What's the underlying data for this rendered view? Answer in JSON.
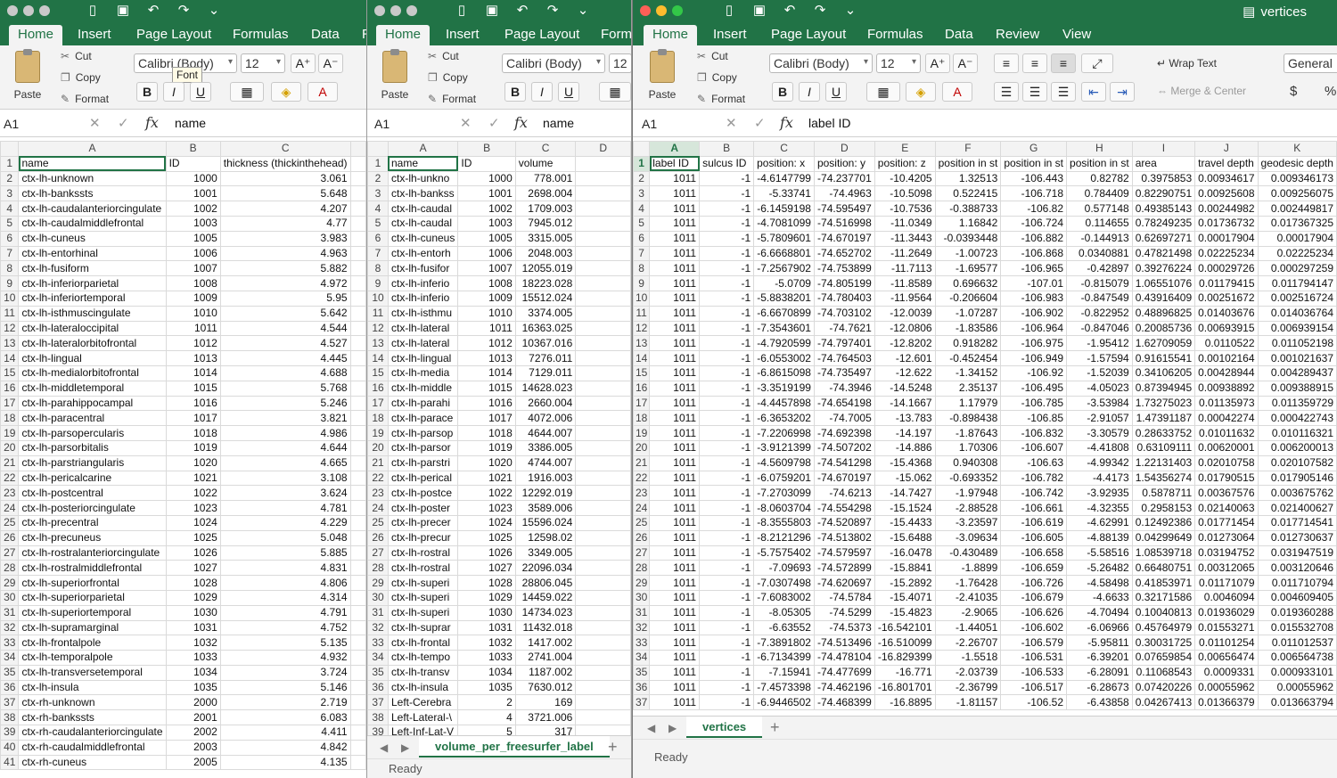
{
  "colors": {
    "accent": "#217346",
    "ribbon_bg": "#f3f3f3"
  },
  "icons": [
    "close-light",
    "minimize-light",
    "zoom-light",
    "sidebar-icon",
    "save-icon",
    "undo-icon",
    "redo-icon",
    "customize-icon",
    "cut-icon",
    "copy-icon",
    "format-painter-icon",
    "excel-doc-icon"
  ],
  "win1": {
    "tabs": [
      "Home",
      "Insert",
      "Page Layout",
      "Formulas",
      "Data",
      "R"
    ],
    "font_name": "Calibri (Body)",
    "font_size": "12",
    "tooltip": "Font",
    "clip": {
      "paste": "Paste",
      "cut": "Cut",
      "copy": "Copy",
      "format": "Format"
    },
    "namebox": "A1",
    "formula": "name",
    "headers": [
      "A",
      "B",
      "C"
    ],
    "rows": [
      [
        "name",
        "ID",
        "thickness (thickinthehead)"
      ],
      [
        "ctx-lh-unknown",
        "1000",
        "3.061"
      ],
      [
        "ctx-lh-bankssts",
        "1001",
        "5.648"
      ],
      [
        "ctx-lh-caudalanteriorcingulate",
        "1002",
        "4.207"
      ],
      [
        "ctx-lh-caudalmiddlefrontal",
        "1003",
        "4.77"
      ],
      [
        "ctx-lh-cuneus",
        "1005",
        "3.983"
      ],
      [
        "ctx-lh-entorhinal",
        "1006",
        "4.963"
      ],
      [
        "ctx-lh-fusiform",
        "1007",
        "5.882"
      ],
      [
        "ctx-lh-inferiorparietal",
        "1008",
        "4.972"
      ],
      [
        "ctx-lh-inferiortemporal",
        "1009",
        "5.95"
      ],
      [
        "ctx-lh-isthmuscingulate",
        "1010",
        "5.642"
      ],
      [
        "ctx-lh-lateraloccipital",
        "1011",
        "4.544"
      ],
      [
        "ctx-lh-lateralorbitofrontal",
        "1012",
        "4.527"
      ],
      [
        "ctx-lh-lingual",
        "1013",
        "4.445"
      ],
      [
        "ctx-lh-medialorbitofrontal",
        "1014",
        "4.688"
      ],
      [
        "ctx-lh-middletemporal",
        "1015",
        "5.768"
      ],
      [
        "ctx-lh-parahippocampal",
        "1016",
        "5.246"
      ],
      [
        "ctx-lh-paracentral",
        "1017",
        "3.821"
      ],
      [
        "ctx-lh-parsopercularis",
        "1018",
        "4.986"
      ],
      [
        "ctx-lh-parsorbitalis",
        "1019",
        "4.644"
      ],
      [
        "ctx-lh-parstriangularis",
        "1020",
        "4.665"
      ],
      [
        "ctx-lh-pericalcarine",
        "1021",
        "3.108"
      ],
      [
        "ctx-lh-postcentral",
        "1022",
        "3.624"
      ],
      [
        "ctx-lh-posteriorcingulate",
        "1023",
        "4.781"
      ],
      [
        "ctx-lh-precentral",
        "1024",
        "4.229"
      ],
      [
        "ctx-lh-precuneus",
        "1025",
        "5.048"
      ],
      [
        "ctx-lh-rostralanteriorcingulate",
        "1026",
        "5.885"
      ],
      [
        "ctx-lh-rostralmiddlefrontal",
        "1027",
        "4.831"
      ],
      [
        "ctx-lh-superiorfrontal",
        "1028",
        "4.806"
      ],
      [
        "ctx-lh-superiorparietal",
        "1029",
        "4.314"
      ],
      [
        "ctx-lh-superiortemporal",
        "1030",
        "4.791"
      ],
      [
        "ctx-lh-supramarginal",
        "1031",
        "4.752"
      ],
      [
        "ctx-lh-frontalpole",
        "1032",
        "5.135"
      ],
      [
        "ctx-lh-temporalpole",
        "1033",
        "4.932"
      ],
      [
        "ctx-lh-transversetemporal",
        "1034",
        "3.724"
      ],
      [
        "ctx-lh-insula",
        "1035",
        "5.146"
      ],
      [
        "ctx-rh-unknown",
        "2000",
        "2.719"
      ],
      [
        "ctx-rh-bankssts",
        "2001",
        "6.083"
      ],
      [
        "ctx-rh-caudalanteriorcingulate",
        "2002",
        "4.411"
      ],
      [
        "ctx-rh-caudalmiddlefrontal",
        "2003",
        "4.842"
      ],
      [
        "ctx-rh-cuneus",
        "2005",
        "4.135"
      ]
    ]
  },
  "win2": {
    "tabs": [
      "Home",
      "Insert",
      "Page Layout",
      "Form"
    ],
    "font_name": "Calibri (Body)",
    "font_size": "12",
    "clip": {
      "paste": "Paste",
      "cut": "Cut",
      "copy": "Copy",
      "format": "Format"
    },
    "namebox": "A1",
    "formula": "name",
    "headers": [
      "A",
      "B",
      "C",
      "D"
    ],
    "rows": [
      [
        "name",
        "ID",
        "volume"
      ],
      [
        "ctx-lh-unkno",
        "1000",
        "778.001"
      ],
      [
        "ctx-lh-bankss",
        "1001",
        "2698.004"
      ],
      [
        "ctx-lh-caudal",
        "1002",
        "1709.003"
      ],
      [
        "ctx-lh-caudal",
        "1003",
        "7945.012"
      ],
      [
        "ctx-lh-cuneus",
        "1005",
        "3315.005"
      ],
      [
        "ctx-lh-entorh",
        "1006",
        "2048.003"
      ],
      [
        "ctx-lh-fusifor",
        "1007",
        "12055.019"
      ],
      [
        "ctx-lh-inferio",
        "1008",
        "18223.028"
      ],
      [
        "ctx-lh-inferio",
        "1009",
        "15512.024"
      ],
      [
        "ctx-lh-isthmu",
        "1010",
        "3374.005"
      ],
      [
        "ctx-lh-lateral",
        "1011",
        "16363.025"
      ],
      [
        "ctx-lh-lateral",
        "1012",
        "10367.016"
      ],
      [
        "ctx-lh-lingual",
        "1013",
        "7276.011"
      ],
      [
        "ctx-lh-media",
        "1014",
        "7129.011"
      ],
      [
        "ctx-lh-middle",
        "1015",
        "14628.023"
      ],
      [
        "ctx-lh-parahi",
        "1016",
        "2660.004"
      ],
      [
        "ctx-lh-parace",
        "1017",
        "4072.006"
      ],
      [
        "ctx-lh-parsop",
        "1018",
        "4644.007"
      ],
      [
        "ctx-lh-parsor",
        "1019",
        "3386.005"
      ],
      [
        "ctx-lh-parstri",
        "1020",
        "4744.007"
      ],
      [
        "ctx-lh-perical",
        "1021",
        "1916.003"
      ],
      [
        "ctx-lh-postce",
        "1022",
        "12292.019"
      ],
      [
        "ctx-lh-poster",
        "1023",
        "3589.006"
      ],
      [
        "ctx-lh-precer",
        "1024",
        "15596.024"
      ],
      [
        "ctx-lh-precur",
        "1025",
        "12598.02"
      ],
      [
        "ctx-lh-rostral",
        "1026",
        "3349.005"
      ],
      [
        "ctx-lh-rostral",
        "1027",
        "22096.034"
      ],
      [
        "ctx-lh-superi",
        "1028",
        "28806.045"
      ],
      [
        "ctx-lh-superi",
        "1029",
        "14459.022"
      ],
      [
        "ctx-lh-superi",
        "1030",
        "14734.023"
      ],
      [
        "ctx-lh-suprar",
        "1031",
        "11432.018"
      ],
      [
        "ctx-lh-frontal",
        "1032",
        "1417.002"
      ],
      [
        "ctx-lh-tempo",
        "1033",
        "2741.004"
      ],
      [
        "ctx-lh-transv",
        "1034",
        "1187.002"
      ],
      [
        "ctx-lh-insula",
        "1035",
        "7630.012"
      ],
      [
        "Left-Cerebra",
        "2",
        "169"
      ],
      [
        "Left-Lateral-\\",
        "4",
        "3721.006"
      ],
      [
        "Left-Inf-Lat-V",
        "5",
        "317"
      ]
    ],
    "sheet": "volume_per_freesurfer_label",
    "plus": "+",
    "status": "Ready"
  },
  "win3": {
    "title": "vertices",
    "tabs": [
      "Home",
      "Insert",
      "Page Layout",
      "Formulas",
      "Data",
      "Review",
      "View"
    ],
    "font_name": "Calibri (Body)",
    "font_size": "12",
    "clip": {
      "paste": "Paste",
      "cut": "Cut",
      "copy": "Copy",
      "format": "Format"
    },
    "wrap": "Wrap Text",
    "merge": "Merge & Center",
    "numfmt": "General",
    "dollar": "$",
    "pct": "%",
    "namebox": "A1",
    "formula": "label ID",
    "headers": [
      "A",
      "B",
      "C",
      "D",
      "E",
      "F",
      "G",
      "H",
      "I",
      "J",
      "K"
    ],
    "rows": [
      [
        "label ID",
        "sulcus ID",
        "position: x",
        "position: y",
        "position: z",
        "position in st",
        "position in st",
        "position in st",
        "area",
        "travel depth",
        "geodesic depth"
      ],
      [
        "1011",
        "-1",
        "-4.6147799",
        "-74.237701",
        "-10.4205",
        "1.32513",
        "-106.443",
        "0.82782",
        "0.3975853",
        "0.00934617",
        "0.009346173"
      ],
      [
        "1011",
        "-1",
        "-5.33741",
        "-74.4963",
        "-10.5098",
        "0.522415",
        "-106.718",
        "0.784409",
        "0.82290751",
        "0.00925608",
        "0.009256075"
      ],
      [
        "1011",
        "-1",
        "-6.1459198",
        "-74.595497",
        "-10.7536",
        "-0.388733",
        "-106.82",
        "0.577148",
        "0.49385143",
        "0.00244982",
        "0.002449817"
      ],
      [
        "1011",
        "-1",
        "-4.7081099",
        "-74.516998",
        "-11.0349",
        "1.16842",
        "-106.724",
        "0.114655",
        "0.78249235",
        "0.01736732",
        "0.017367325"
      ],
      [
        "1011",
        "-1",
        "-5.7809601",
        "-74.670197",
        "-11.3443",
        "-0.0393448",
        "-106.882",
        "-0.144913",
        "0.62697271",
        "0.00017904",
        "0.00017904"
      ],
      [
        "1011",
        "-1",
        "-6.6668801",
        "-74.652702",
        "-11.2649",
        "-1.00723",
        "-106.868",
        "0.0340881",
        "0.47821498",
        "0.02225234",
        "0.02225234"
      ],
      [
        "1011",
        "-1",
        "-7.2567902",
        "-74.753899",
        "-11.7113",
        "-1.69577",
        "-106.965",
        "-0.42897",
        "0.39276224",
        "0.00029726",
        "0.000297259"
      ],
      [
        "1011",
        "-1",
        "-5.0709",
        "-74.805199",
        "-11.8589",
        "0.696632",
        "-107.01",
        "-0.815079",
        "1.06551076",
        "0.01179415",
        "0.011794147"
      ],
      [
        "1011",
        "-1",
        "-5.8838201",
        "-74.780403",
        "-11.9564",
        "-0.206604",
        "-106.983",
        "-0.847549",
        "0.43916409",
        "0.00251672",
        "0.002516724"
      ],
      [
        "1011",
        "-1",
        "-6.6670899",
        "-74.703102",
        "-12.0039",
        "-1.07287",
        "-106.902",
        "-0.822952",
        "0.48896825",
        "0.01403676",
        "0.014036764"
      ],
      [
        "1011",
        "-1",
        "-7.3543601",
        "-74.7621",
        "-12.0806",
        "-1.83586",
        "-106.964",
        "-0.847046",
        "0.20085736",
        "0.00693915",
        "0.006939154"
      ],
      [
        "1011",
        "-1",
        "-4.7920599",
        "-74.797401",
        "-12.8202",
        "0.918282",
        "-106.975",
        "-1.95412",
        "1.62709059",
        "0.0110522",
        "0.011052198"
      ],
      [
        "1011",
        "-1",
        "-6.0553002",
        "-74.764503",
        "-12.601",
        "-0.452454",
        "-106.949",
        "-1.57594",
        "0.91615541",
        "0.00102164",
        "0.001021637"
      ],
      [
        "1011",
        "-1",
        "-6.8615098",
        "-74.735497",
        "-12.622",
        "-1.34152",
        "-106.92",
        "-1.52039",
        "0.34106205",
        "0.00428944",
        "0.004289437"
      ],
      [
        "1011",
        "-1",
        "-3.3519199",
        "-74.3946",
        "-14.5248",
        "2.35137",
        "-106.495",
        "-4.05023",
        "0.87394945",
        "0.00938892",
        "0.009388915"
      ],
      [
        "1011",
        "-1",
        "-4.4457898",
        "-74.654198",
        "-14.1667",
        "1.17979",
        "-106.785",
        "-3.53984",
        "1.73275023",
        "0.01135973",
        "0.011359729"
      ],
      [
        "1011",
        "-1",
        "-6.3653202",
        "-74.7005",
        "-13.783",
        "-0.898438",
        "-106.85",
        "-2.91057",
        "1.47391187",
        "0.00042274",
        "0.000422743"
      ],
      [
        "1011",
        "-1",
        "-7.2206998",
        "-74.692398",
        "-14.197",
        "-1.87643",
        "-106.832",
        "-3.30579",
        "0.28633752",
        "0.01011632",
        "0.010116321"
      ],
      [
        "1011",
        "-1",
        "-3.9121399",
        "-74.507202",
        "-14.886",
        "1.70306",
        "-106.607",
        "-4.41808",
        "0.63109111",
        "0.00620001",
        "0.006200013"
      ],
      [
        "1011",
        "-1",
        "-4.5609798",
        "-74.541298",
        "-15.4368",
        "0.940308",
        "-106.63",
        "-4.99342",
        "1.22131403",
        "0.02010758",
        "0.020107582"
      ],
      [
        "1011",
        "-1",
        "-6.0759201",
        "-74.670197",
        "-15.062",
        "-0.693352",
        "-106.782",
        "-4.4173",
        "1.54356274",
        "0.01790515",
        "0.017905146"
      ],
      [
        "1011",
        "-1",
        "-7.2703099",
        "-74.6213",
        "-14.7427",
        "-1.97948",
        "-106.742",
        "-3.92935",
        "0.5878711",
        "0.00367576",
        "0.003675762"
      ],
      [
        "1011",
        "-1",
        "-8.0603704",
        "-74.554298",
        "-15.1524",
        "-2.88528",
        "-106.661",
        "-4.32355",
        "0.2958153",
        "0.02140063",
        "0.021400627"
      ],
      [
        "1011",
        "-1",
        "-8.3555803",
        "-74.520897",
        "-15.4433",
        "-3.23597",
        "-106.619",
        "-4.62991",
        "0.12492386",
        "0.01771454",
        "0.017714541"
      ],
      [
        "1011",
        "-1",
        "-8.2121296",
        "-74.513802",
        "-15.6488",
        "-3.09634",
        "-106.605",
        "-4.88139",
        "0.04299649",
        "0.01273064",
        "0.012730637"
      ],
      [
        "1011",
        "-1",
        "-5.7575402",
        "-74.579597",
        "-16.0478",
        "-0.430489",
        "-106.658",
        "-5.58516",
        "1.08539718",
        "0.03194752",
        "0.031947519"
      ],
      [
        "1011",
        "-1",
        "-7.09693",
        "-74.572899",
        "-15.8841",
        "-1.8899",
        "-106.659",
        "-5.26482",
        "0.66480751",
        "0.00312065",
        "0.003120646"
      ],
      [
        "1011",
        "-1",
        "-7.0307498",
        "-74.620697",
        "-15.2892",
        "-1.76428",
        "-106.726",
        "-4.58498",
        "0.41853971",
        "0.01171079",
        "0.011710794"
      ],
      [
        "1011",
        "-1",
        "-7.6083002",
        "-74.5784",
        "-15.4071",
        "-2.41035",
        "-106.679",
        "-4.6633",
        "0.32171586",
        "0.0046094",
        "0.004609405"
      ],
      [
        "1011",
        "-1",
        "-8.05305",
        "-74.5299",
        "-15.4823",
        "-2.9065",
        "-106.626",
        "-4.70494",
        "0.10040813",
        "0.01936029",
        "0.019360288"
      ],
      [
        "1011",
        "-1",
        "-6.63552",
        "-74.5373",
        "-16.542101",
        "-1.44051",
        "-106.602",
        "-6.06966",
        "0.45764979",
        "0.01553271",
        "0.015532708"
      ],
      [
        "1011",
        "-1",
        "-7.3891802",
        "-74.513496",
        "-16.510099",
        "-2.26707",
        "-106.579",
        "-5.95811",
        "0.30031725",
        "0.01101254",
        "0.011012537"
      ],
      [
        "1011",
        "-1",
        "-6.7134399",
        "-74.478104",
        "-16.829399",
        "-1.5518",
        "-106.531",
        "-6.39201",
        "0.07659854",
        "0.00656474",
        "0.006564738"
      ],
      [
        "1011",
        "-1",
        "-7.15941",
        "-74.477699",
        "-16.771",
        "-2.03739",
        "-106.533",
        "-6.28091",
        "0.11068543",
        "0.0009331",
        "0.000933101"
      ],
      [
        "1011",
        "-1",
        "-7.4573398",
        "-74.462196",
        "-16.801701",
        "-2.36799",
        "-106.517",
        "-6.28673",
        "0.07420226",
        "0.00055962",
        "0.00055962"
      ],
      [
        "1011",
        "-1",
        "-6.9446502",
        "-74.468399",
        "-16.8895",
        "-1.81157",
        "-106.52",
        "-6.43858",
        "0.04267413",
        "0.01366379",
        "0.013663794"
      ]
    ],
    "sheet": "vertices",
    "plus": "+",
    "status": "Ready"
  }
}
